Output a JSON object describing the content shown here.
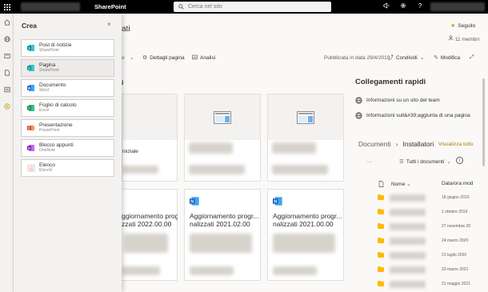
{
  "topbar": {
    "app_name": "SharePoint",
    "search_placeholder": "Cerca nel sito",
    "icons": [
      "megaphone-icon",
      "gear-icon",
      "help-icon"
    ],
    "help_glyph": "?"
  },
  "rail": {
    "icons": [
      "home-icon",
      "globe-icon",
      "news-icon",
      "file-icon",
      "list-icon",
      "create-icon"
    ]
  },
  "create_panel": {
    "title": "Crea",
    "close_glyph": "×",
    "items": [
      {
        "name": "Post di notizie",
        "sub": "SharePoint",
        "icon": "sharepoint-news-icon",
        "color": "#038387"
      },
      {
        "name": "Pagina",
        "sub": "SharePoint",
        "icon": "sharepoint-page-icon",
        "color": "#038387"
      },
      {
        "name": "Documento",
        "sub": "Word",
        "icon": "word-icon",
        "color": "#185abd"
      },
      {
        "name": "Foglio di calcolo",
        "sub": "Excel",
        "icon": "excel-icon",
        "color": "#107c41"
      },
      {
        "name": "Presentazione",
        "sub": "PowerPoint",
        "icon": "powerpoint-icon",
        "color": "#c43e1c"
      },
      {
        "name": "Blocco appunti",
        "sub": "OneNote",
        "icon": "onenote-icon",
        "color": "#7719aa"
      },
      {
        "name": "Elenco",
        "sub": "Elenchi",
        "icon": "list-icon",
        "color": "#c8c6c4"
      }
    ],
    "selected_index": 1
  },
  "page": {
    "title_fragment": "ati",
    "follow_label": "Seguito",
    "members_label": "11 membri"
  },
  "commandbar": {
    "fragment": "o",
    "page_details": "Dettagli pagina",
    "analytics": "Analisi",
    "published": "Pubblicata in data 29/4/2019",
    "share": "Condividi",
    "edit": "Modifica"
  },
  "news": {
    "section_fragment": "i",
    "card_frag": "iniziale",
    "cards_row2": [
      {
        "title_line1": "ggiornamento progr...",
        "title_line2": "zzati 2022.00.00"
      },
      {
        "title_line1": "Aggiornamento progr...",
        "title_line2": "nalizzati 2021.02.00"
      },
      {
        "title_line1": "Aggiornamento progr...",
        "title_line2": "nalizzati 2021.00.00"
      }
    ]
  },
  "quick_links": {
    "title": "Collegamenti rapidi",
    "links": [
      "Informazioni su un sito del team",
      "Informazioni sull&#39;aggiunta di una pagina"
    ]
  },
  "documents": {
    "breadcrumb_root": "Documenti",
    "breadcrumb_current": "Installatori",
    "see_all": "Visualizza tutto",
    "more": "···",
    "view_name": "Tutti i documenti",
    "col_name": "Nome",
    "col_date": "Data/ora mod",
    "dates": [
      "18 giugno 2019",
      "1 ottobre 2019",
      "27 novembre 20",
      "24 marzo 2020",
      "21 luglio 2020",
      "23 marzo 2021",
      "21 maggio 2021"
    ]
  }
}
